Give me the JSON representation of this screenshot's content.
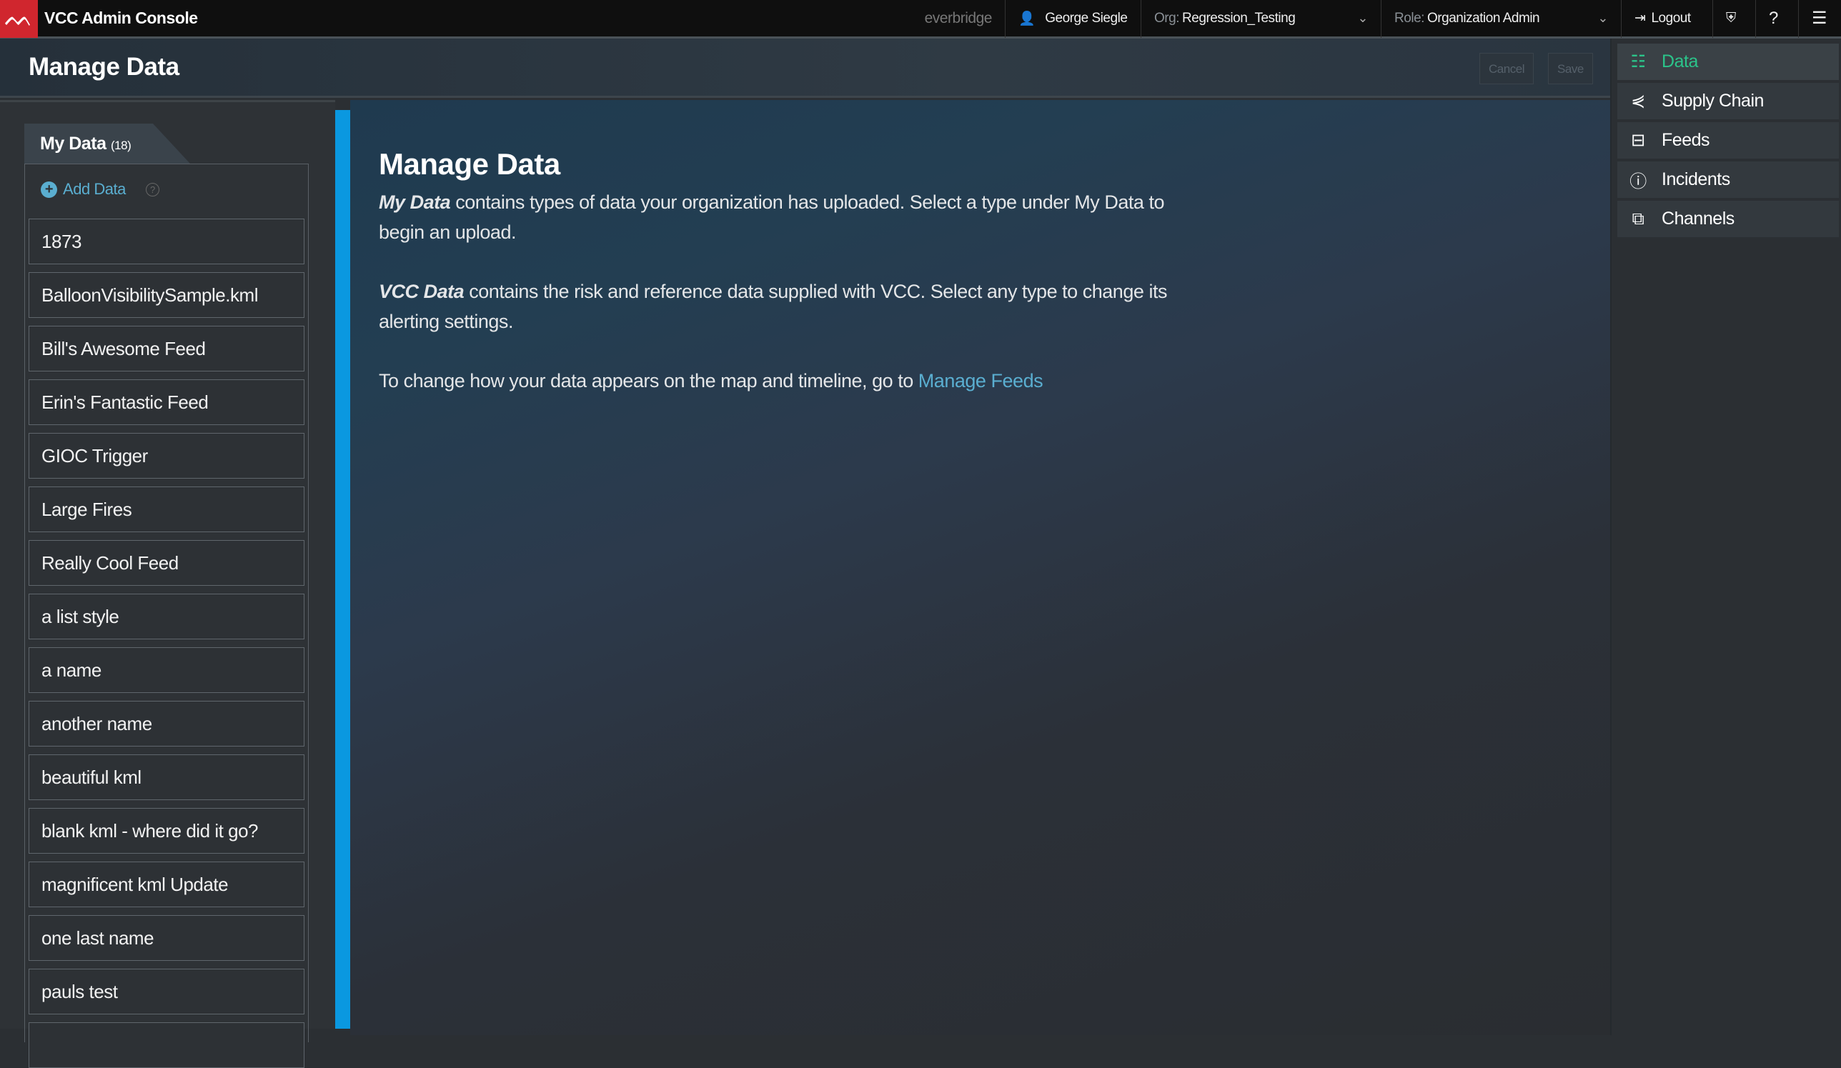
{
  "topbar": {
    "app_title": "VCC Admin Console",
    "brand": "everbridge",
    "user": "George Siegle",
    "org_label": "Org:",
    "org_value": "Regression_Testing",
    "role_label": "Role:",
    "role_value": "Organization Admin",
    "logout": "Logout"
  },
  "header": {
    "title": "Manage Data",
    "cancel": "Cancel",
    "save": "Save"
  },
  "left": {
    "tab_label": "My Data",
    "tab_count": "(18)",
    "add_data": "Add Data",
    "items": [
      "1873",
      "BalloonVisibilitySample.kml",
      "Bill's Awesome Feed",
      "Erin's Fantastic Feed",
      "GIOC Trigger",
      "Large Fires",
      "Really Cool Feed",
      "a list style",
      "a name",
      "another name",
      "beautiful kml",
      "blank kml - where did it go?",
      "magnificent kml Update",
      "one last name",
      "pauls test",
      ""
    ]
  },
  "main": {
    "title": "Manage Data",
    "p1_em": "My Data",
    "p1": " contains types of data your organization has uploaded. Select a type under My Data to begin an upload.",
    "p2_em": "VCC Data",
    "p2": " contains the risk and reference data supplied with VCC. Select any type to change its alerting settings.",
    "p3": "To change how your data appears on the map and timeline, go to ",
    "p3_link": "Manage Feeds"
  },
  "nav": [
    {
      "label": "Data",
      "icon": "list-icon",
      "active": true
    },
    {
      "label": "Supply Chain",
      "icon": "share-icon"
    },
    {
      "label": "Feeds",
      "icon": "rss-icon"
    },
    {
      "label": "Incidents",
      "icon": "alert-icon"
    },
    {
      "label": "Channels",
      "icon": "channels-icon"
    }
  ],
  "colors": {
    "accent": "#0a98e0",
    "active_nav": "#2bc48a",
    "link": "#5aaed0",
    "brand_red": "#d0262e"
  }
}
